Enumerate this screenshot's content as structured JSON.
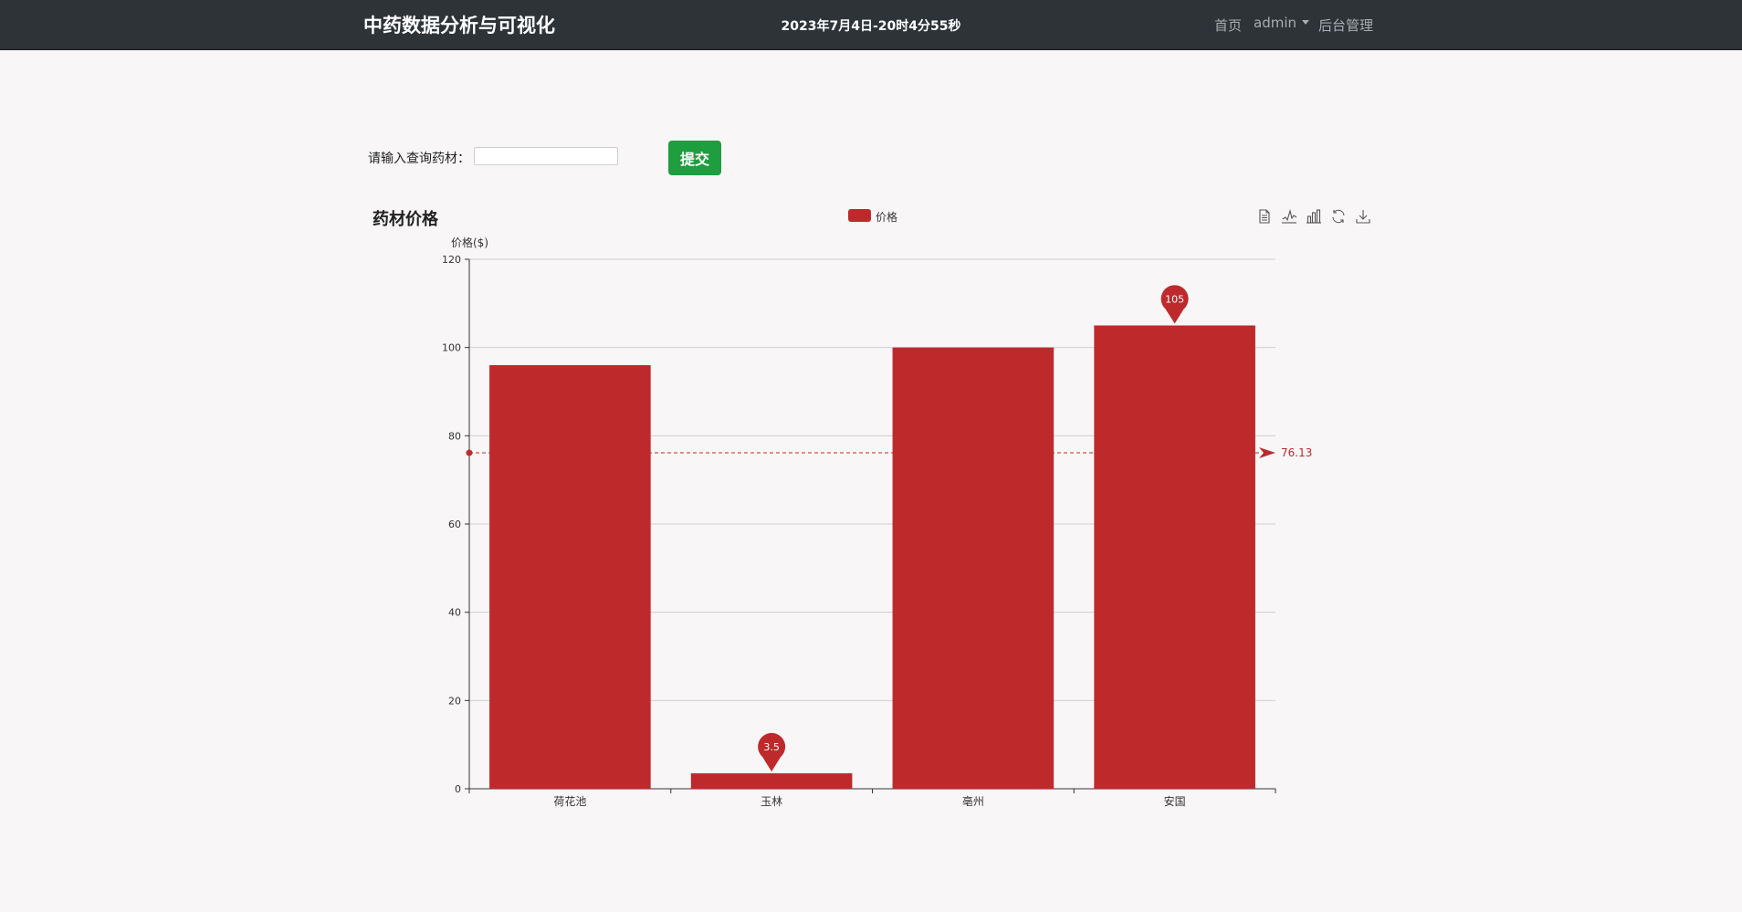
{
  "navbar": {
    "brand": "中药数据分析与可视化",
    "clock": "2023年7月4日-20时4分55秒",
    "home_label": "首页",
    "user_label": "admin",
    "admin_label": "后台管理"
  },
  "search": {
    "label": "请输入查询药材：",
    "value": "",
    "placeholder": "",
    "submit_label": "提交"
  },
  "toolbox": {
    "icons": [
      "data-view-icon",
      "line-chart-icon",
      "bar-chart-icon",
      "restore-icon",
      "save-image-icon"
    ]
  },
  "chart_data": {
    "type": "bar",
    "title": "药材价格",
    "ylabel": "价格($)",
    "xlabel": "",
    "legend": [
      "价格"
    ],
    "legend_position": "top-center",
    "categories": [
      "荷花池",
      "玉林",
      "亳州",
      "安国"
    ],
    "series": [
      {
        "name": "价格",
        "values": [
          96,
          3.5,
          100,
          105
        ],
        "color": "#be2a2c"
      }
    ],
    "ylim": [
      0,
      120
    ],
    "yticks": [
      "0",
      "20",
      "40",
      "60",
      "80",
      "100",
      "120"
    ],
    "mark_points": [
      {
        "label": "105",
        "category": "安国",
        "value": 105
      },
      {
        "label": "3.5",
        "category": "玉林",
        "value": 3.5
      }
    ],
    "mark_line": {
      "label": "76.13",
      "value": 76.13,
      "style": "dashed"
    },
    "grid": true
  }
}
